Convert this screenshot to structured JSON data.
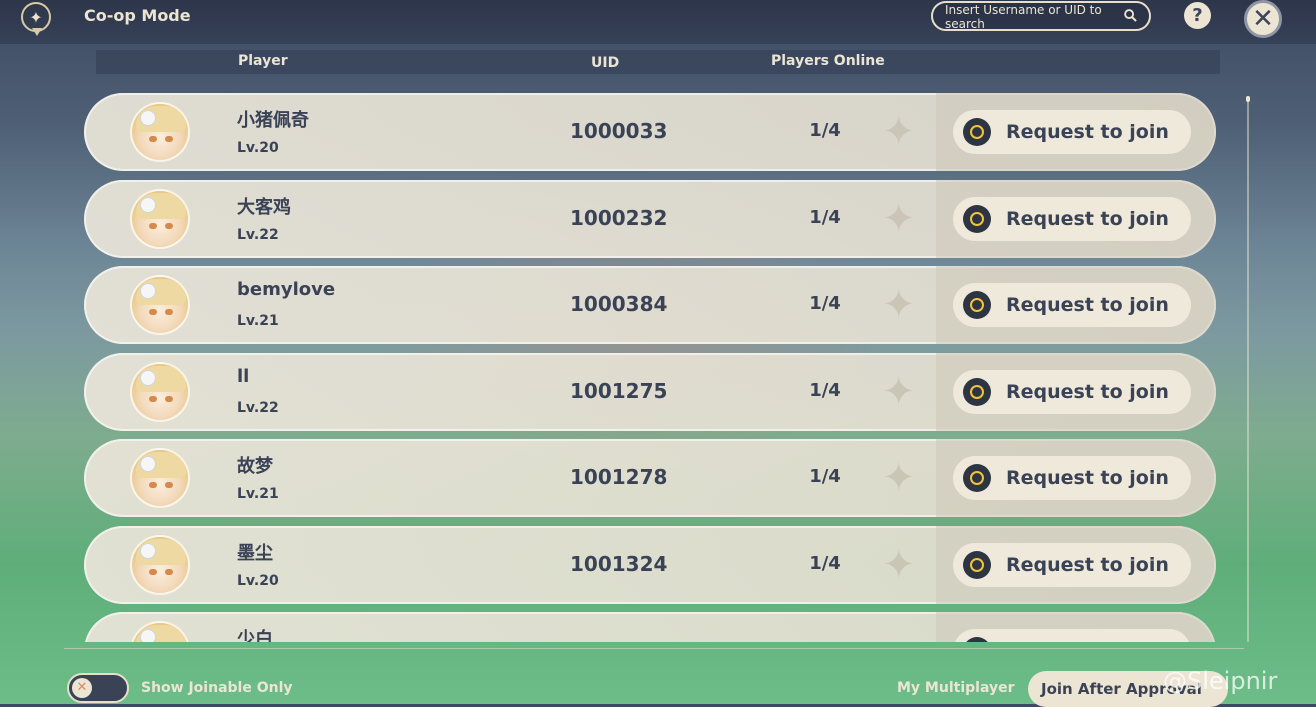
{
  "header": {
    "title": "Co-op Mode",
    "search_placeholder": "Insert Username or UID to search",
    "help_label": "?",
    "close_label": "✕"
  },
  "columns": {
    "player": "Player",
    "uid": "UID",
    "online": "Players Online"
  },
  "rows": [
    {
      "name": "小猪佩奇",
      "level": "Lv.20",
      "uid": "1000033",
      "online": "1/4",
      "action": "Request to join"
    },
    {
      "name": "大客鸡",
      "level": "Lv.22",
      "uid": "1000232",
      "online": "1/4",
      "action": "Request to join"
    },
    {
      "name": "bemylove",
      "level": "Lv.21",
      "uid": "1000384",
      "online": "1/4",
      "action": "Request to join"
    },
    {
      "name": "ll",
      "level": "Lv.22",
      "uid": "1001275",
      "online": "1/4",
      "action": "Request to join"
    },
    {
      "name": "故梦",
      "level": "Lv.21",
      "uid": "1001278",
      "online": "1/4",
      "action": "Request to join"
    },
    {
      "name": "墨尘",
      "level": "Lv.20",
      "uid": "1001324",
      "online": "1/4",
      "action": "Request to join"
    },
    {
      "name": "少白",
      "level": "",
      "uid": "",
      "online": "",
      "action": ""
    }
  ],
  "footer": {
    "toggle_label": "Show Joinable Only",
    "toggle_on": false,
    "my_multiplayer": "My Multiplayer",
    "join_mode": "Join After Approval",
    "watermark": "@Sleipnir"
  },
  "colors": {
    "accent": "#f2c43c",
    "text_dark": "#3a4255",
    "text_light": "#ece5d3"
  }
}
